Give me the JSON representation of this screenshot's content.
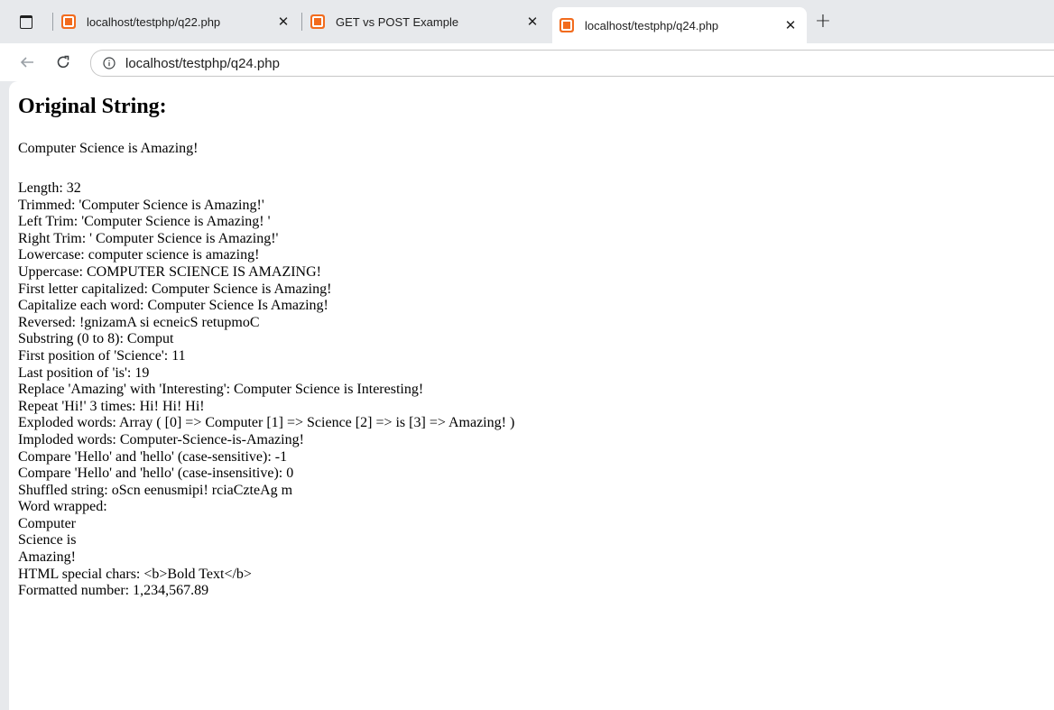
{
  "browser": {
    "tabs": [
      {
        "title": "localhost/testphp/q22.php",
        "active": false
      },
      {
        "title": "GET vs POST Example",
        "active": false
      },
      {
        "title": "localhost/testphp/q24.php",
        "active": true
      }
    ],
    "close_glyph": "✕",
    "new_tab_glyph": "+",
    "url": "localhost/testphp/q24.php",
    "favicon_color": "#f26b1d"
  },
  "page": {
    "heading": "Original String:",
    "original": "Computer Science is Amazing!",
    "lines": [
      "Length: 32",
      "Trimmed: 'Computer Science is Amazing!'",
      "Left Trim: 'Computer Science is Amazing! '",
      "Right Trim: ' Computer Science is Amazing!'",
      "Lowercase: computer science is amazing!",
      "Uppercase: COMPUTER SCIENCE IS AMAZING!",
      "First letter capitalized: Computer Science is Amazing!",
      "Capitalize each word: Computer Science Is Amazing!",
      "Reversed: !gnizamA si ecneicS retupmoC",
      "Substring (0 to 8): Comput",
      "First position of 'Science': 11",
      "Last position of 'is': 19",
      "Replace 'Amazing' with 'Interesting': Computer Science is Interesting!",
      "Repeat 'Hi!' 3 times: Hi! Hi! Hi!",
      "Exploded words: Array ( [0] => Computer [1] => Science [2] => is [3] => Amazing! )",
      "Imploded words: Computer-Science-is-Amazing!",
      "Compare 'Hello' and 'hello' (case-sensitive): -1",
      "Compare 'Hello' and 'hello' (case-insensitive): 0",
      "Shuffled string: oScn eenusmipi! rciaCzteAg m",
      "Word wrapped:",
      "Computer",
      "Science is",
      "Amazing!",
      "HTML special chars: <b>Bold Text</b>",
      "Formatted number: 1,234,567.89"
    ]
  }
}
